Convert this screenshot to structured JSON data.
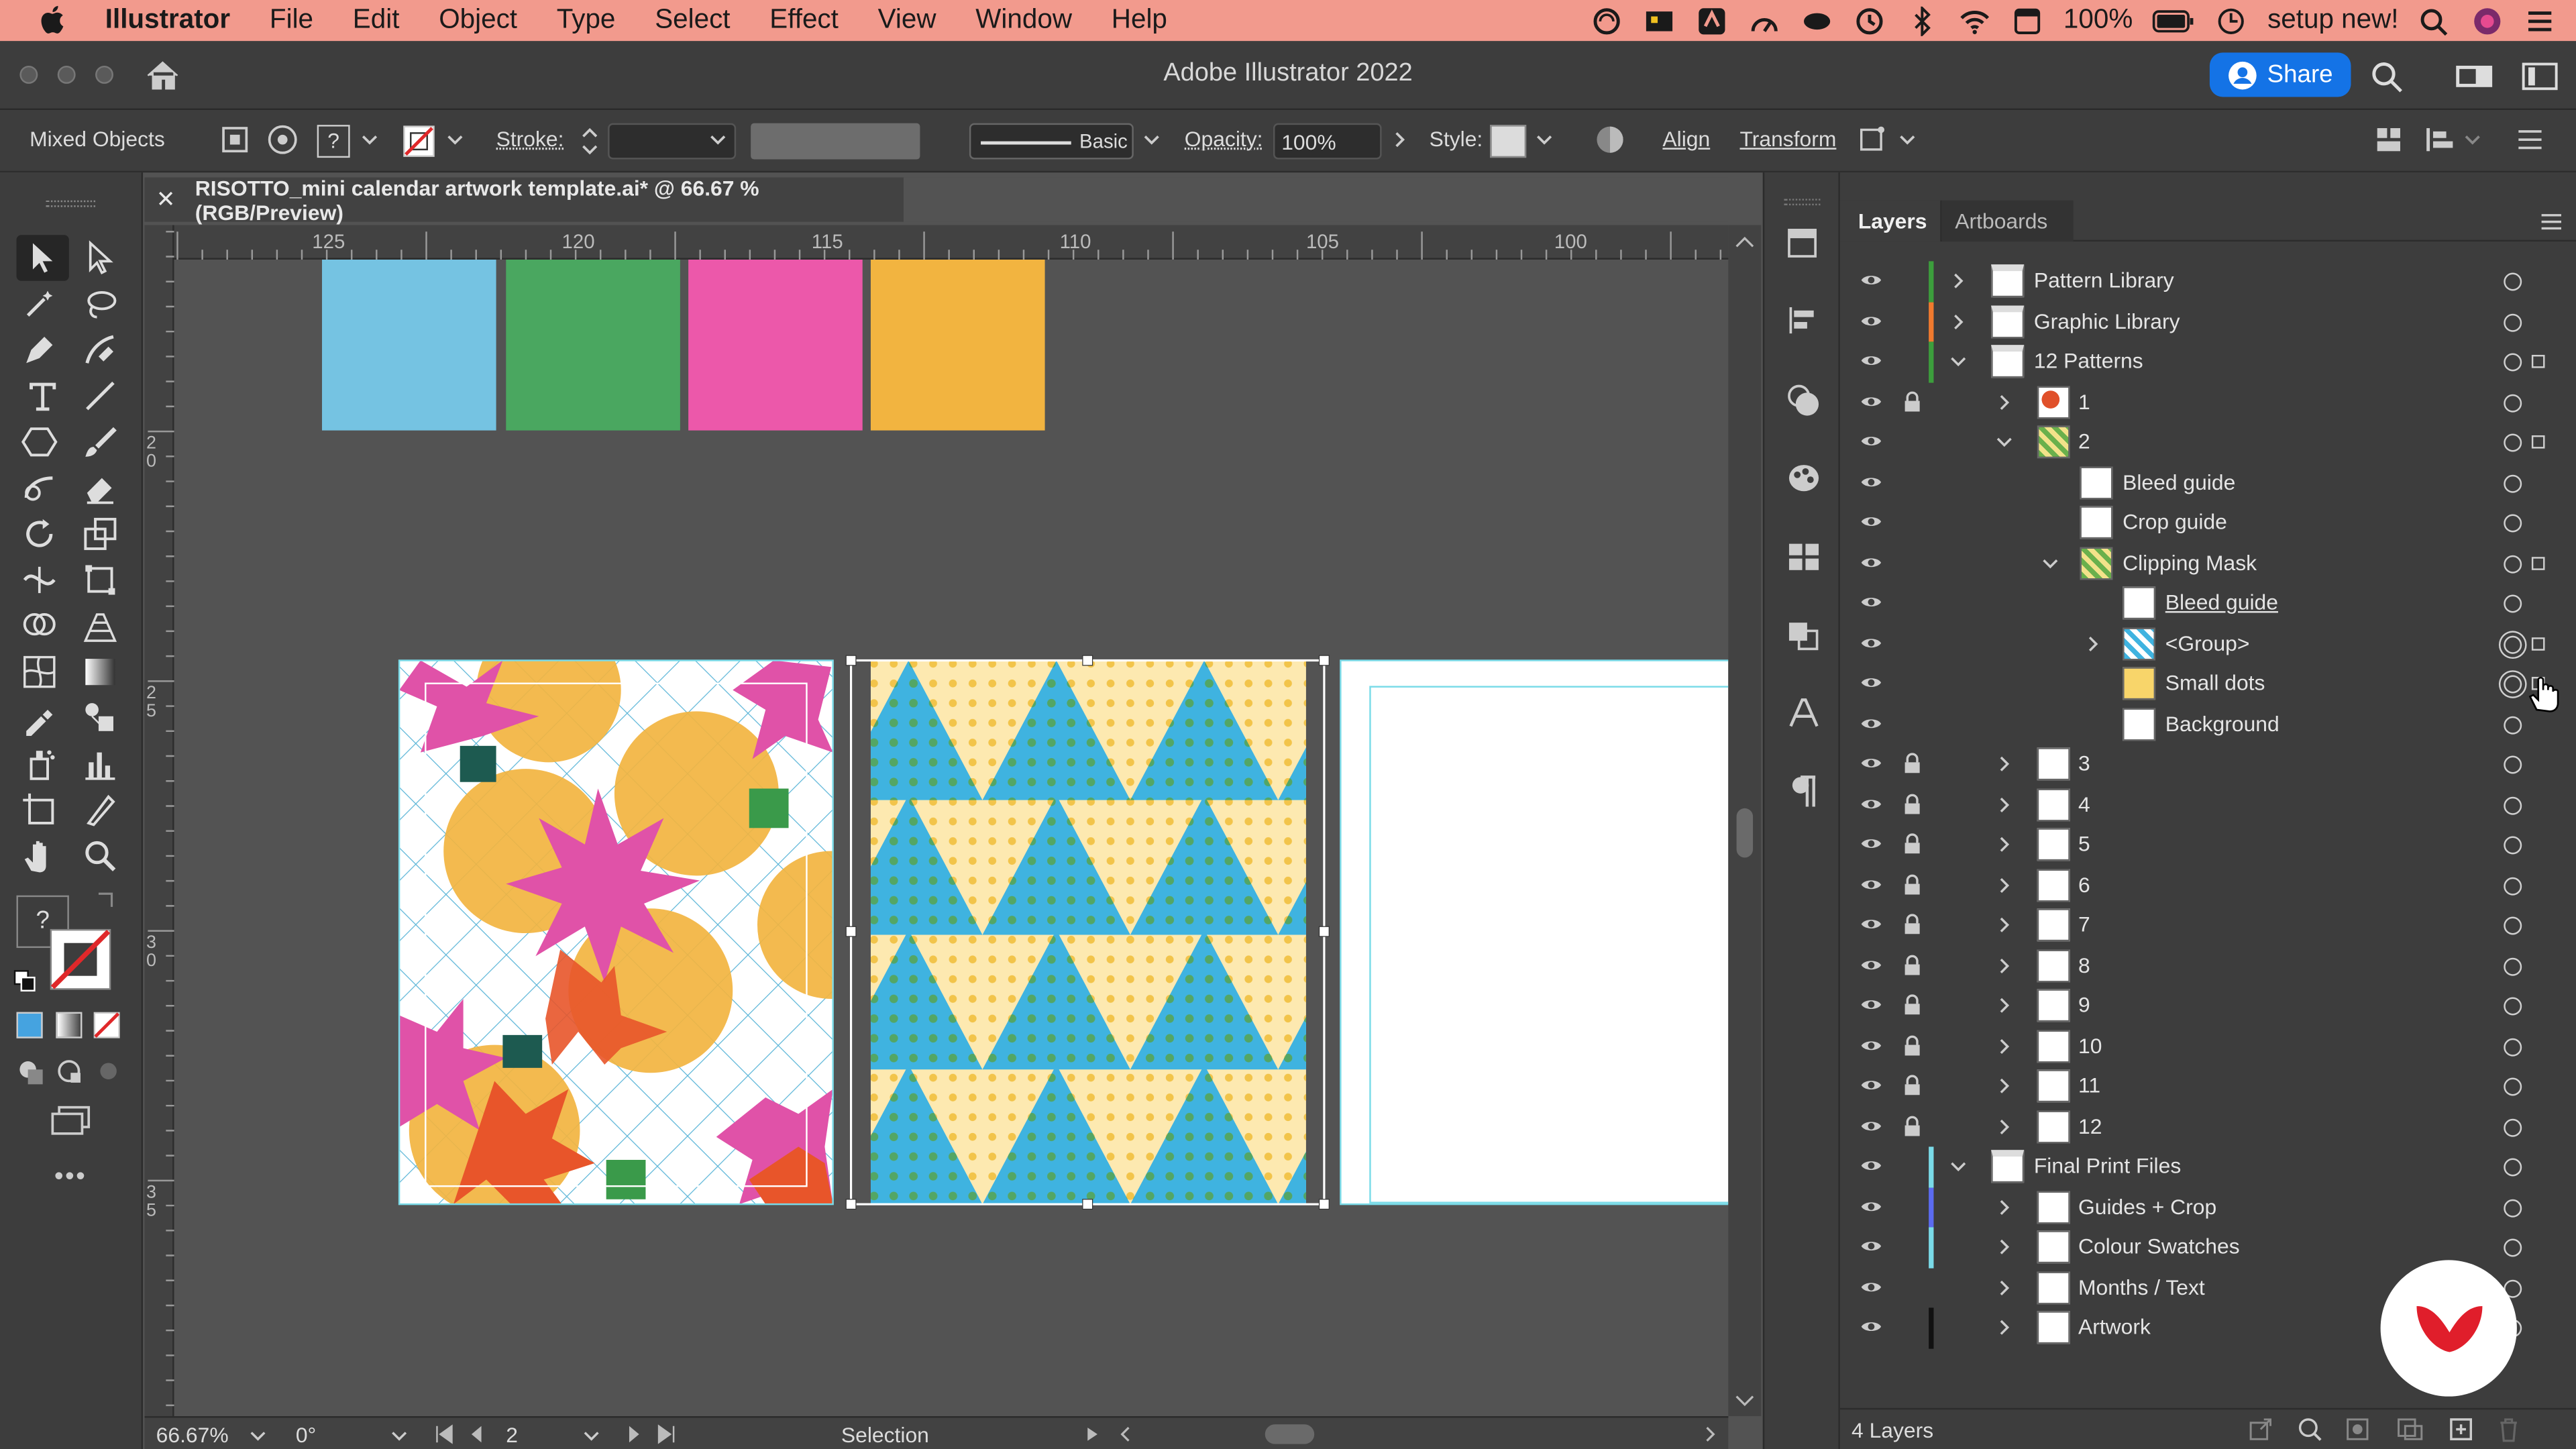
{
  "menubar": {
    "app": "Illustrator",
    "items": [
      "File",
      "Edit",
      "Object",
      "Type",
      "Select",
      "Effect",
      "View",
      "Window",
      "Help"
    ],
    "battery": "100%",
    "user": "setup new!"
  },
  "window": {
    "title": "Adobe Illustrator 2022",
    "share_label": "Share"
  },
  "control_bar": {
    "selection_type": "Mixed Objects",
    "stroke_label": "Stroke:",
    "brush_label": "Basic",
    "opacity_label": "Opacity:",
    "opacity_value": "100%",
    "style_label": "Style:",
    "align_label": "Align",
    "transform_label": "Transform"
  },
  "document_tab": {
    "title": "RISOTTO_mini calendar artwork template.ai* @ 66.67 % (RGB/Preview)"
  },
  "ruler": {
    "h_ticks": [
      "125",
      "120",
      "115",
      "110",
      "105",
      "100"
    ],
    "v_ticks": [
      "20",
      "25",
      "30",
      "35"
    ]
  },
  "toolbar": {
    "unknown_fill": "?"
  },
  "swatches": {
    "colors": [
      "#75c3e2",
      "#4aa760",
      "#ec58aa",
      "#f2b440"
    ]
  },
  "status": {
    "zoom": "66.67%",
    "rotation": "0°",
    "artboard": "2",
    "mode": "Selection"
  },
  "layers_panel": {
    "tabs": [
      "Layers",
      "Artboards"
    ],
    "footer": "4 Layers",
    "rows": [
      {
        "label": "Pattern Library",
        "indent": 0,
        "chev": "right",
        "lock": false,
        "color": "#3c9e3c",
        "thumb": "doc"
      },
      {
        "label": "Graphic Library",
        "indent": 0,
        "chev": "right",
        "lock": false,
        "color": "#f07a2e",
        "thumb": "doc"
      },
      {
        "label": "12 Patterns",
        "indent": 0,
        "chev": "down",
        "lock": false,
        "color": "#3c9e3c",
        "thumb": "doc",
        "sel": true
      },
      {
        "label": "1",
        "indent": 1,
        "chev": "right",
        "lock": true,
        "color": "",
        "thumb": "pat1"
      },
      {
        "label": "2",
        "indent": 1,
        "chev": "down",
        "lock": false,
        "color": "",
        "thumb": "pat2",
        "sel": true
      },
      {
        "label": "Bleed guide",
        "indent": 2,
        "chev": "",
        "lock": false,
        "color": "",
        "thumb": "white"
      },
      {
        "label": "Crop guide",
        "indent": 2,
        "chev": "",
        "lock": false,
        "color": "",
        "thumb": "white"
      },
      {
        "label": "Clipping Mask",
        "indent": 2,
        "chev": "down",
        "lock": false,
        "color": "",
        "thumb": "pat2",
        "sel": true
      },
      {
        "label": "Bleed guide",
        "indent": 3,
        "chev": "",
        "lock": false,
        "color": "",
        "thumb": "white",
        "underline": true
      },
      {
        "label": "<Group>",
        "indent": 3,
        "chev": "right",
        "lock": false,
        "color": "",
        "thumb": "blue",
        "sel": true,
        "dbl": true
      },
      {
        "label": "Small dots",
        "indent": 3,
        "chev": "",
        "lock": false,
        "color": "",
        "thumb": "yellow",
        "sel": true,
        "dbl": true
      },
      {
        "label": "Background",
        "indent": 3,
        "chev": "",
        "lock": false,
        "color": "",
        "thumb": "white"
      },
      {
        "label": "3",
        "indent": 1,
        "chev": "right",
        "lock": true,
        "color": "",
        "thumb": "white"
      },
      {
        "label": "4",
        "indent": 1,
        "chev": "right",
        "lock": true,
        "color": "",
        "thumb": "white"
      },
      {
        "label": "5",
        "indent": 1,
        "chev": "right",
        "lock": true,
        "color": "",
        "thumb": "white"
      },
      {
        "label": "6",
        "indent": 1,
        "chev": "right",
        "lock": true,
        "color": "",
        "thumb": "white"
      },
      {
        "label": "7",
        "indent": 1,
        "chev": "right",
        "lock": true,
        "color": "",
        "thumb": "white"
      },
      {
        "label": "8",
        "indent": 1,
        "chev": "right",
        "lock": true,
        "color": "",
        "thumb": "white"
      },
      {
        "label": "9",
        "indent": 1,
        "chev": "right",
        "lock": true,
        "color": "",
        "thumb": "white"
      },
      {
        "label": "10",
        "indent": 1,
        "chev": "right",
        "lock": true,
        "color": "",
        "thumb": "white"
      },
      {
        "label": "11",
        "indent": 1,
        "chev": "right",
        "lock": true,
        "color": "",
        "thumb": "white"
      },
      {
        "label": "12",
        "indent": 1,
        "chev": "right",
        "lock": true,
        "color": "",
        "thumb": "white"
      },
      {
        "label": "Final Print Files",
        "indent": 0,
        "chev": "down",
        "lock": false,
        "color": "#7adbe8",
        "thumb": "doc"
      },
      {
        "label": "Guides + Crop",
        "indent": 1,
        "chev": "right",
        "lock": false,
        "color": "#5b6bf0",
        "thumb": "white"
      },
      {
        "label": "Colour Swatches",
        "indent": 1,
        "chev": "right",
        "lock": false,
        "color": "#7adbe8",
        "thumb": "white"
      },
      {
        "label": "Months / Text",
        "indent": 1,
        "chev": "right",
        "lock": false,
        "color": "",
        "thumb": "white"
      },
      {
        "label": "Artwork",
        "indent": 1,
        "chev": "right",
        "lock": false,
        "color": "#111111",
        "thumb": "white"
      }
    ]
  }
}
